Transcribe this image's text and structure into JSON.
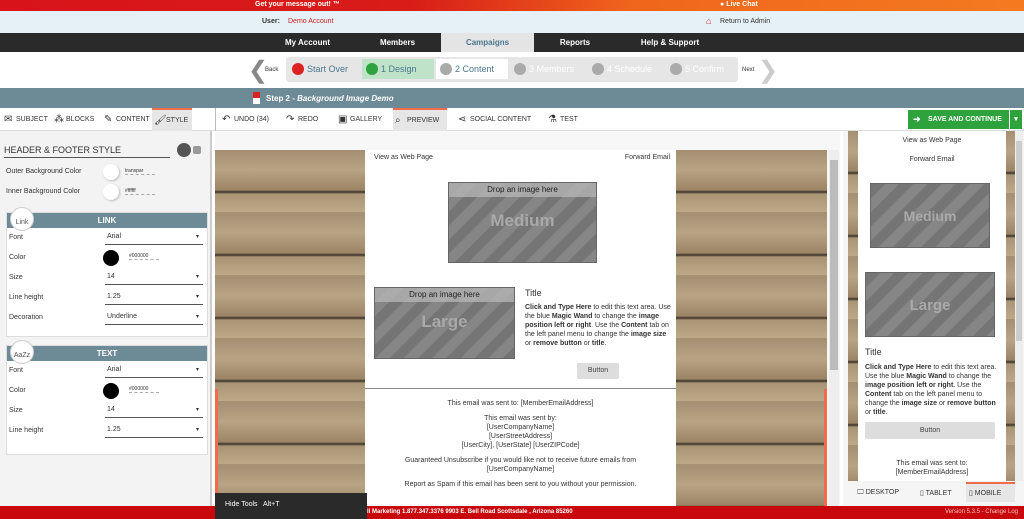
{
  "topbar": {
    "message": "Get your message out! ™",
    "live_chat": "Live Chat"
  },
  "userbar": {
    "user_label": "User:",
    "user_name": "Demo Account",
    "return_admin": "Return to Admin"
  },
  "nav": {
    "items": [
      {
        "label": "My Account"
      },
      {
        "label": "Members"
      },
      {
        "label": "Campaigns",
        "active": true
      },
      {
        "label": "Reports"
      },
      {
        "label": "Help & Support"
      }
    ]
  },
  "steps": {
    "back": "Back",
    "next": "Next",
    "items": [
      {
        "label": "Start Over"
      },
      {
        "label": "1 Design"
      },
      {
        "label": "2 Content"
      },
      {
        "label": "3 Members"
      },
      {
        "label": "4 Schedule"
      },
      {
        "label": "5 Confirm"
      }
    ]
  },
  "step_header": {
    "prefix": "Step 2 - ",
    "name": "Background Image Demo"
  },
  "left_tabs": [
    {
      "label": "SUBJECT",
      "icon": "envelope-icon"
    },
    {
      "label": "BLOCKS",
      "icon": "blocks-icon"
    },
    {
      "label": "CONTENT",
      "icon": "pencil-icon"
    },
    {
      "label": "STYLE",
      "icon": "brush-icon",
      "active": true
    }
  ],
  "tools": [
    {
      "label": "UNDO (34)",
      "icon": "undo-icon"
    },
    {
      "label": "REDO",
      "icon": "redo-icon"
    },
    {
      "label": "GALLERY",
      "icon": "image-icon"
    },
    {
      "label": "PREVIEW",
      "icon": "search-icon",
      "active": true
    },
    {
      "label": "SOCIAL CONTENT",
      "icon": "share-icon"
    },
    {
      "label": "TEST",
      "icon": "flask-icon"
    }
  ],
  "save_label": "SAVE AND CONTINUE",
  "style_panel": {
    "title": "HEADER & FOOTER STYLE",
    "outer_bg": {
      "label": "Outer Background Color",
      "value": "transpar"
    },
    "inner_bg": {
      "label": "Inner Background Color",
      "value": "#ffffff"
    },
    "link": {
      "badge": "Link",
      "title": "LINK",
      "font_label": "Font",
      "font": "Arial",
      "color_label": "Color",
      "color": "#000000",
      "size_label": "Size",
      "size": "14",
      "lh_label": "Line height",
      "lh": "1.25",
      "dec_label": "Decoration",
      "dec": "Underline"
    },
    "text": {
      "badge": "AaZz",
      "title": "TEXT",
      "font_label": "Font",
      "font": "Arial",
      "color_label": "Color",
      "color": "#000000",
      "size_label": "Size",
      "size": "14",
      "lh_label": "Line height",
      "lh": "1.25"
    }
  },
  "email": {
    "view_web": "View as Web Page",
    "forward": "Forward Email",
    "drop": "Drop an image here",
    "medium": "Medium",
    "large": "Large",
    "title": "Title",
    "body": {
      "b1": "Click and Type Here",
      "t1": " to edit this text area. Use the blue ",
      "b2": "Magic Wand",
      "t2": " to change the ",
      "b3": "image position left or right",
      "t3": ". Use the ",
      "b4": "Content",
      "t4": " tab on the left panel menu to change the ",
      "b5": "image size",
      "t5": " or ",
      "b6": "remove button",
      "t6": " or ",
      "b7": "title",
      "t7": "."
    },
    "button": "Button",
    "sent_to": "This email was sent to: ",
    "member_email": "[MemberEmailAddress]",
    "sent_by": "This email was sent by:",
    "company": "[UserCompanyName]",
    "street": "[UserStreetAddress]",
    "city": "[UserCity], [UserState] [UserZIPCode]",
    "unsub": "Guaranteed Unsubscribe",
    "unsub_text": " if you would like not to receive future emails from",
    "spam": "Report as Spam",
    "spam_text": " if this email has been sent to you without your permission."
  },
  "devices": [
    {
      "label": "DESKTOP",
      "icon": "desktop-icon"
    },
    {
      "label": "TABLET",
      "icon": "tablet-icon"
    },
    {
      "label": "MOBILE",
      "icon": "mobile-icon",
      "active": true
    }
  ],
  "hide_tools": {
    "label": "Hide Tools",
    "shortcut": "Alt+T"
  },
  "footer": {
    "address": "ll Marketing  1.877.347.3376  9903 E. Bell Road Scottsdale , Arizona 85260",
    "version": "Version 5.3.5 - Change Log"
  },
  "colors": {
    "accent_red": "#c8080c",
    "save_green": "#2ea23c",
    "header_blue": "#6d8b97",
    "nav_dark": "#2a2a2a"
  }
}
